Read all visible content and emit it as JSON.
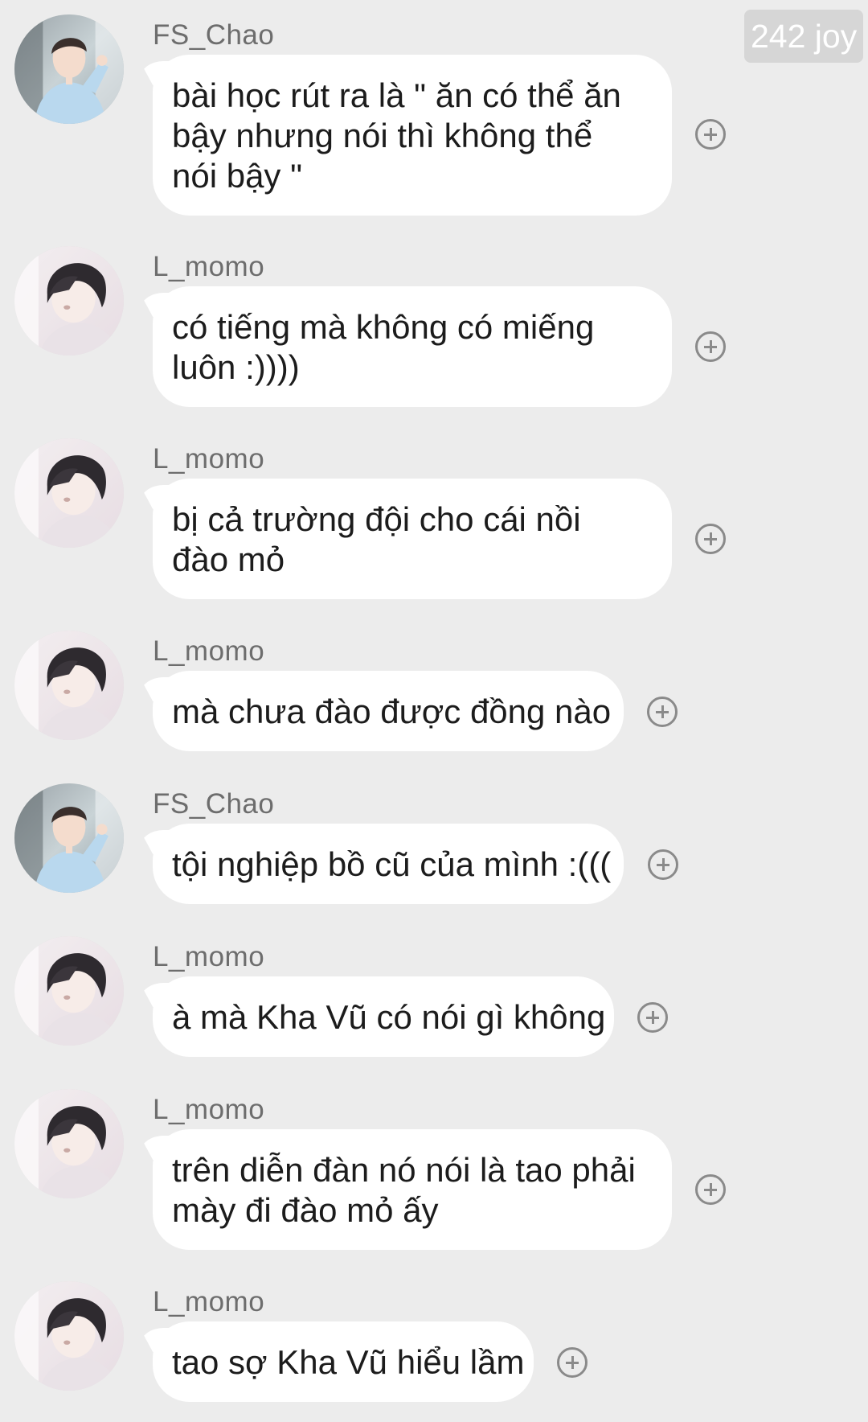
{
  "watermark": {
    "text": "242 joy"
  },
  "messages": [
    {
      "user": "FS_Chao",
      "text": "bài học rút ra là \" ăn có thể ăn bậy nhưng nói thì không thể nói bậy \"",
      "avatar": "avatar-fs-chao"
    },
    {
      "user": "L_momo",
      "text": "có tiếng mà không có miếng luôn :))))",
      "avatar": "avatar-l-momo"
    },
    {
      "user": "L_momo",
      "text": "bị cả trường đội cho cái nồi đào mỏ",
      "avatar": "avatar-l-momo"
    },
    {
      "user": "L_momo",
      "text": "mà chưa đào được đồng nào",
      "avatar": "avatar-l-momo"
    },
    {
      "user": "FS_Chao",
      "text": "tội nghiệp bồ cũ của mình :(((",
      "avatar": "avatar-fs-chao"
    },
    {
      "user": "L_momo",
      "text": "à mà Kha Vũ có nói gì không",
      "avatar": "avatar-l-momo"
    },
    {
      "user": "L_momo",
      "text": "trên diễn đàn nó nói là tao phải mày đi đào mỏ ấy",
      "avatar": "avatar-l-momo"
    },
    {
      "user": "L_momo",
      "text": "tao sợ Kha Vũ hiểu lầm",
      "avatar": "avatar-l-momo"
    }
  ],
  "icons": {
    "add_reaction": "plus-circle-icon"
  },
  "colors": {
    "background": "#ececec",
    "bubble": "#ffffff",
    "username": "#6d6d6d",
    "text": "#1c1c1c",
    "icon": "#8a8a8a",
    "watermark_bg": "#d6d6d6"
  }
}
